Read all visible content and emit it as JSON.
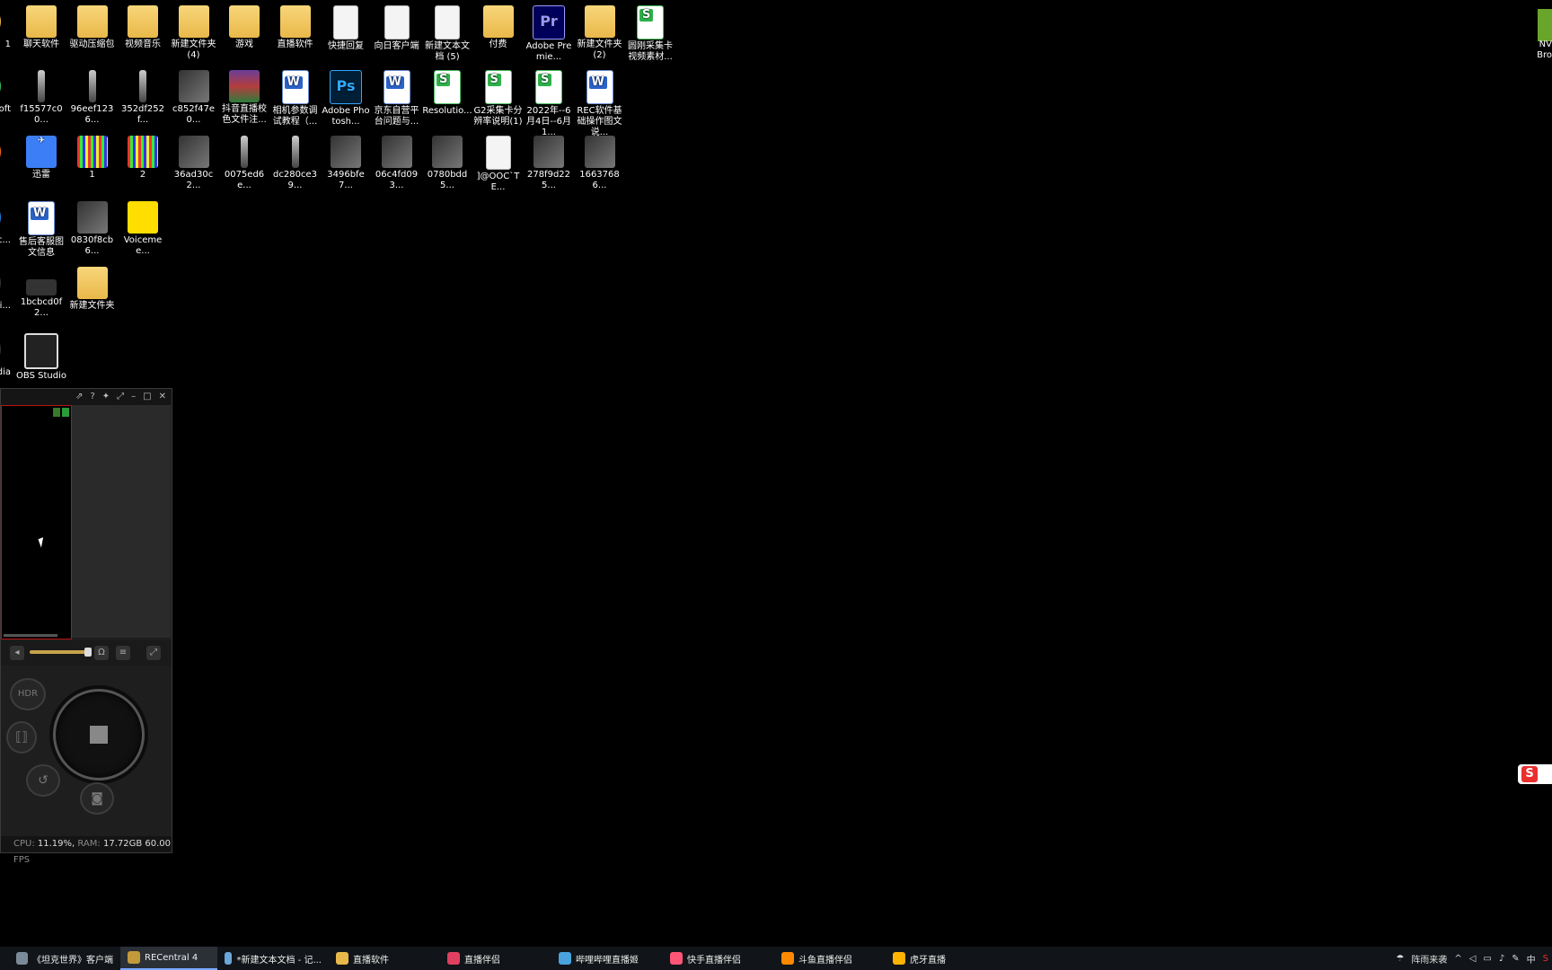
{
  "desktop": {
    "icons": [
      {
        "label": "聊天软件",
        "kind": "folder"
      },
      {
        "label": "驱动压缩包",
        "kind": "folder"
      },
      {
        "label": "视频音乐",
        "kind": "folder"
      },
      {
        "label": "新建文件夹 (4)",
        "kind": "folder"
      },
      {
        "label": "游戏",
        "kind": "folder"
      },
      {
        "label": "直播软件",
        "kind": "folder"
      },
      {
        "label": "快捷回复",
        "kind": "doc"
      },
      {
        "label": "向日客户端",
        "kind": "doc"
      },
      {
        "label": "新建文本文档 (5)",
        "kind": "doc"
      },
      {
        "label": "付费",
        "kind": "folder"
      },
      {
        "label": "Adobe Premie...",
        "kind": "pr"
      },
      {
        "label": "新建文件夹 (2)",
        "kind": "folder"
      },
      {
        "label": "圆刚采集卡视频素材...",
        "kind": "excel"
      },
      {
        "label": "f15577c00...",
        "kind": "strip"
      },
      {
        "label": "96eef1236...",
        "kind": "strip"
      },
      {
        "label": "352df252f...",
        "kind": "strip"
      },
      {
        "label": "c852f47e0...",
        "kind": "thumb"
      },
      {
        "label": "抖音直播校色文件注...",
        "kind": "rar"
      },
      {
        "label": "相机参数调试教程（...",
        "kind": "word"
      },
      {
        "label": "Adobe Photosh...",
        "kind": "ps"
      },
      {
        "label": "京东自营平台问题与...",
        "kind": "word"
      },
      {
        "label": "Resolutio...",
        "kind": "excel"
      },
      {
        "label": "G2采集卡分辨率说明(1)",
        "kind": "excel"
      },
      {
        "label": "2022年--6月4日--6月1...",
        "kind": "excel"
      },
      {
        "label": "REC软件基础操作图文说...",
        "kind": "word"
      },
      {
        "label": "迅雷",
        "kind": "thunder"
      },
      {
        "label": "1",
        "kind": "bars"
      },
      {
        "label": "2",
        "kind": "bars"
      },
      {
        "label": "36ad30c2...",
        "kind": "thumb"
      },
      {
        "label": "0075ed6e...",
        "kind": "strip"
      },
      {
        "label": "dc280ce39...",
        "kind": "strip"
      },
      {
        "label": "3496bfe7...",
        "kind": "thumb"
      },
      {
        "label": "06c4fd093...",
        "kind": "thumb"
      },
      {
        "label": "0780bdd5...",
        "kind": "thumb"
      },
      {
        "label": "]@OOC`TE...",
        "kind": "doc"
      },
      {
        "label": "278f9d225...",
        "kind": "thumb"
      },
      {
        "label": "16637686...",
        "kind": "thumb"
      },
      {
        "label": "售后客服图文信息",
        "kind": "word"
      },
      {
        "label": "0830f8cb6...",
        "kind": "thumb"
      },
      {
        "label": "Voicemee...",
        "kind": "voice"
      },
      {
        "label": "1bcbcd0f2...",
        "kind": "key"
      },
      {
        "label": "新建文件夹",
        "kind": "folder"
      },
      {
        "label": "OBS Studio",
        "kind": "obs"
      }
    ],
    "partial_left_labels": [
      "1",
      "oft",
      "",
      "_c...",
      "di...",
      "dia"
    ],
    "partial_right_label": "NV Bro"
  },
  "recentral": {
    "title_buttons": [
      "⇗",
      "?",
      "✦",
      "⤢",
      "–",
      "□",
      "✕"
    ],
    "hdr_label": "HDR",
    "status": {
      "cpu_label": "CPU:",
      "cpu_value": "11.19%,",
      "ram_label": "RAM:",
      "ram_value": "17.72GB",
      "fps_value": "60.00",
      "fps_label": "FPS"
    },
    "volume_level": 0.95
  },
  "taskbar": {
    "items": [
      {
        "label": "《坦克世界》客户端",
        "color": "#7a8a99"
      },
      {
        "label": "RECentral 4",
        "color": "#c29a3a",
        "active": true
      },
      {
        "label": "*新建文本文档 - 记...",
        "color": "#6aa8d8"
      },
      {
        "label": "直播软件",
        "color": "#e9b84a"
      },
      {
        "label": "直播伴侣",
        "color": "#e04060"
      },
      {
        "label": "哔哩哔哩直播姬",
        "color": "#4aa3df"
      },
      {
        "label": "快手直播伴侣",
        "color": "#ff5577"
      },
      {
        "label": "斗鱼直播伴侣",
        "color": "#ff8a00"
      },
      {
        "label": "虎牙直播",
        "color": "#ffb400"
      }
    ],
    "tray": {
      "weather": "阵雨来袭",
      "ime": "中"
    }
  },
  "sogou_label": "S"
}
